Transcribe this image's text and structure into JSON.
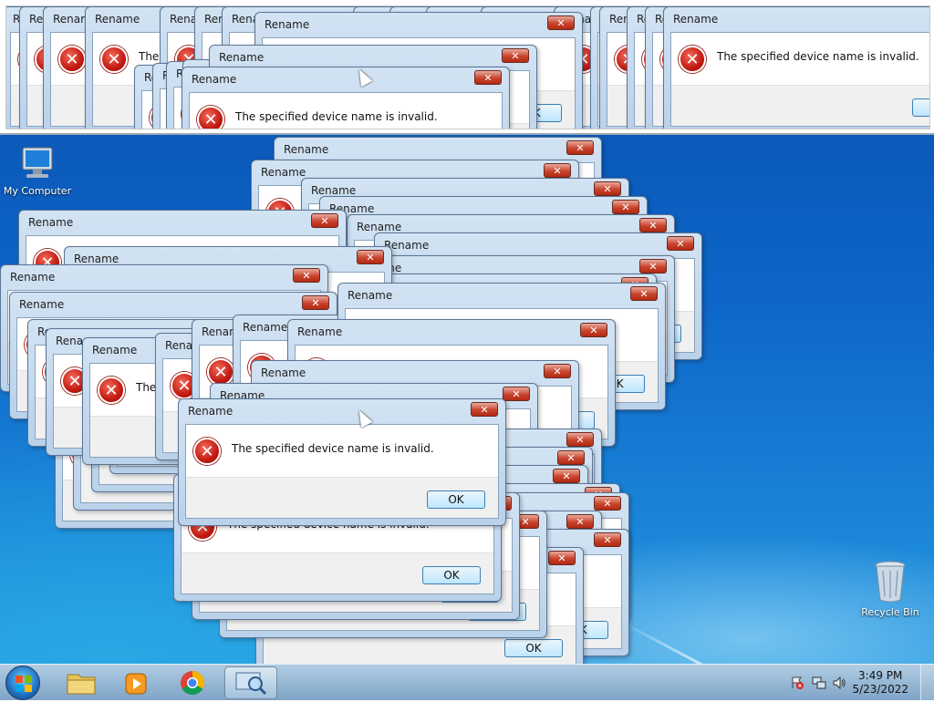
{
  "dialog": {
    "title": "Rename",
    "message": "The specified device name is invalid.",
    "ok_label": "OK",
    "close_glyph": "✕",
    "icon": "error-icon"
  },
  "desktop": {
    "icons": [
      {
        "label": "My Computer",
        "icon": "computer-icon"
      },
      {
        "label": "Recycle Bin",
        "icon": "recycle-bin-icon"
      }
    ]
  },
  "taskbar": {
    "start_icon": "windows-start-icon",
    "pinned": [
      {
        "name": "file-explorer-icon"
      },
      {
        "name": "media-player-icon"
      },
      {
        "name": "chrome-icon"
      },
      {
        "name": "magnifier-icon"
      }
    ],
    "clock_time": "3:49 PM",
    "clock_date": "5/23/2022",
    "tray_icons": [
      "action-center-error-icon",
      "network-icon",
      "volume-icon"
    ]
  },
  "colors": {
    "desktop": "#0d66c8",
    "dialog_frame": "#b9d1ea",
    "close_button": "#c8442d",
    "ok_button": "#bee6fd"
  }
}
